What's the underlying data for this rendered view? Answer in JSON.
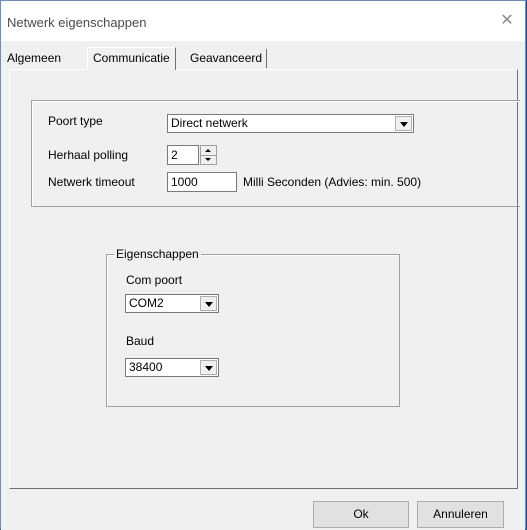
{
  "window": {
    "title": "Netwerk eigenschappen",
    "close_symbol": "✕"
  },
  "tabs": [
    {
      "label": "Algemeen",
      "active": false
    },
    {
      "label": "Communicatie",
      "active": true
    },
    {
      "label": "Geavanceerd",
      "active": false
    }
  ],
  "settings": {
    "port_type_label": "Poort type",
    "port_type_value": "Direct netwerk",
    "polling_label": "Herhaal polling",
    "polling_value": "2",
    "timeout_label": "Netwerk timeout",
    "timeout_value": "1000",
    "timeout_unit": "Milli Seconden (Advies: min. 500)"
  },
  "properties": {
    "legend": "Eigenschappen",
    "com_label": "Com poort",
    "com_value": "COM2",
    "baud_label": "Baud",
    "baud_value": "38400"
  },
  "buttons": {
    "ok": "Ok",
    "cancel": "Annuleren"
  }
}
